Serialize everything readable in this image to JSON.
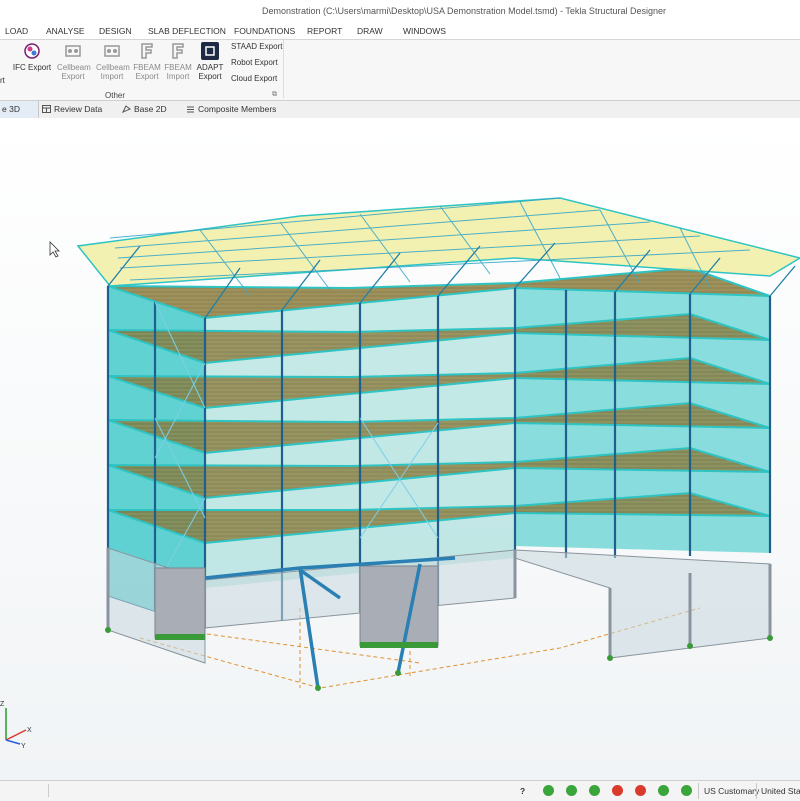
{
  "window": {
    "title": "Demonstration (C:\\Users\\marmi\\Desktop\\USA Demonstration Model.tsmd) - Tekla Structural Designer"
  },
  "menu_tabs": [
    "LOAD",
    "ANALYSE",
    "DESIGN",
    "SLAB DEFLECTION",
    "FOUNDATIONS",
    "REPORT",
    "DRAW",
    "WINDOWS"
  ],
  "ribbon": {
    "cut_label": "rt",
    "ifc_export": "IFC Export",
    "cellbeam_export": [
      "Cellbeam",
      "Export"
    ],
    "cellbeam_import": [
      "Cellbeam",
      "Import"
    ],
    "fbeam_export": [
      "FBEAM",
      "Export"
    ],
    "fbeam_import": [
      "FBEAM",
      "Import"
    ],
    "adapt_export": [
      "ADAPT",
      "Export"
    ],
    "staad_export": "STAAD Export",
    "robot_export": "Robot Export",
    "cloud_export": "Cloud Export",
    "group_label": "Other",
    "launcher": "⧉"
  },
  "view_tabs": {
    "cut_label": "e 3D",
    "review_data": "Review Data",
    "base_2d": "Base 2D",
    "composite_members": "Composite Members"
  },
  "axes": {
    "z": "Z",
    "x": "X",
    "y": "Y"
  },
  "status": {
    "help": "?",
    "units": "US Customary",
    "code": "United State",
    "icon_colors": [
      "#3aa53a",
      "#3aa53a",
      "#3aa53a",
      "#3aa53a",
      "#d93a2b",
      "#d93a2b",
      "#3aa53a"
    ]
  },
  "colors": {
    "steel": "#1f5f8e",
    "glazing": "#2ec4c4",
    "roof_panel": "#f2f0a8",
    "deck": "#8a7a3a",
    "base_frame": "#9aa4ae",
    "support": "#3a9a3a",
    "foundation_line": "#e09030"
  }
}
